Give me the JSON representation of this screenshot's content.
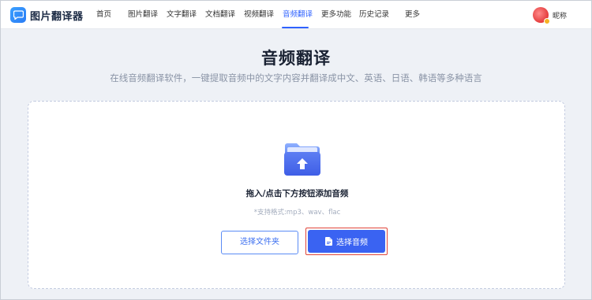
{
  "header": {
    "logo_text": "图片翻译器",
    "nav": [
      {
        "label": "首页"
      },
      {
        "label": "图片翻译"
      },
      {
        "label": "文字翻译"
      },
      {
        "label": "文档翻译"
      },
      {
        "label": "视频翻译"
      },
      {
        "label": "音频翻译",
        "active": true
      },
      {
        "label": "更多功能"
      },
      {
        "label": "历史记录"
      },
      {
        "label": "更多"
      }
    ],
    "user_nickname": "昵称"
  },
  "main": {
    "title": "音频翻译",
    "subtitle": "在线音频翻译软件，一键提取音频中的文字内容并翻译成中文、英语、日语、韩语等多种语言",
    "upload": {
      "hint": "拖入/点击下方按钮添加音频",
      "formats": "*支持格式:mp3、wav、flac",
      "folder_button": "选择文件夹",
      "audio_button": "选择音频"
    }
  },
  "colors": {
    "accent": "#2f62ff",
    "primary_button": "#3a63f2",
    "highlight_border": "#e0453a",
    "page_bg": "#eef1f6"
  },
  "icons": {
    "logo": "chat-bubble-icon",
    "upload": "folder-upload-icon",
    "audio_button": "document-icon",
    "avatar_badge": "badge-icon"
  }
}
